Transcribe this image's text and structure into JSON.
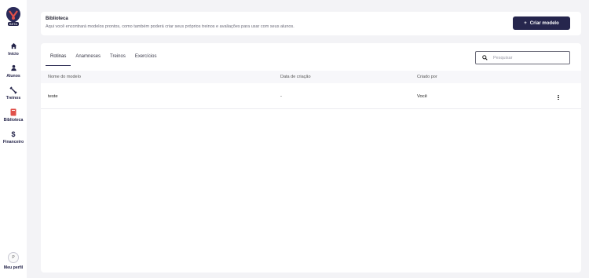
{
  "sidebar": {
    "logo_tag": "BETA",
    "items": [
      {
        "label": "Início",
        "icon": "home-icon"
      },
      {
        "label": "Alunos",
        "icon": "user-icon"
      },
      {
        "label": "Treinos",
        "icon": "dumbbell-icon"
      },
      {
        "label": "Biblioteca",
        "icon": "book-icon",
        "active": true
      },
      {
        "label": "Financeiro",
        "icon": "dollar-icon"
      }
    ],
    "profile_initial": "P",
    "profile_label": "Meu perfil"
  },
  "header": {
    "title": "Biblioteca",
    "subtitle": "Aqui você encontrará modelos prontos, como também poderá criar seus próprios treinos e avaliações para usar com seus alunos.",
    "create_button": "Criar modelo",
    "create_icon": "+"
  },
  "tabs": [
    "Rotinas",
    "Anamneses",
    "Treinos",
    "Exercícios"
  ],
  "active_tab": "Rotinas",
  "search": {
    "placeholder": "Pesquisar"
  },
  "table": {
    "columns": [
      "Nome do modelo",
      "Data de criação",
      "Criado por"
    ],
    "rows": [
      {
        "name": "teste",
        "date": "-",
        "author": "Você"
      }
    ]
  },
  "colors": {
    "accent": "#26264d",
    "book": "#e0504a"
  }
}
